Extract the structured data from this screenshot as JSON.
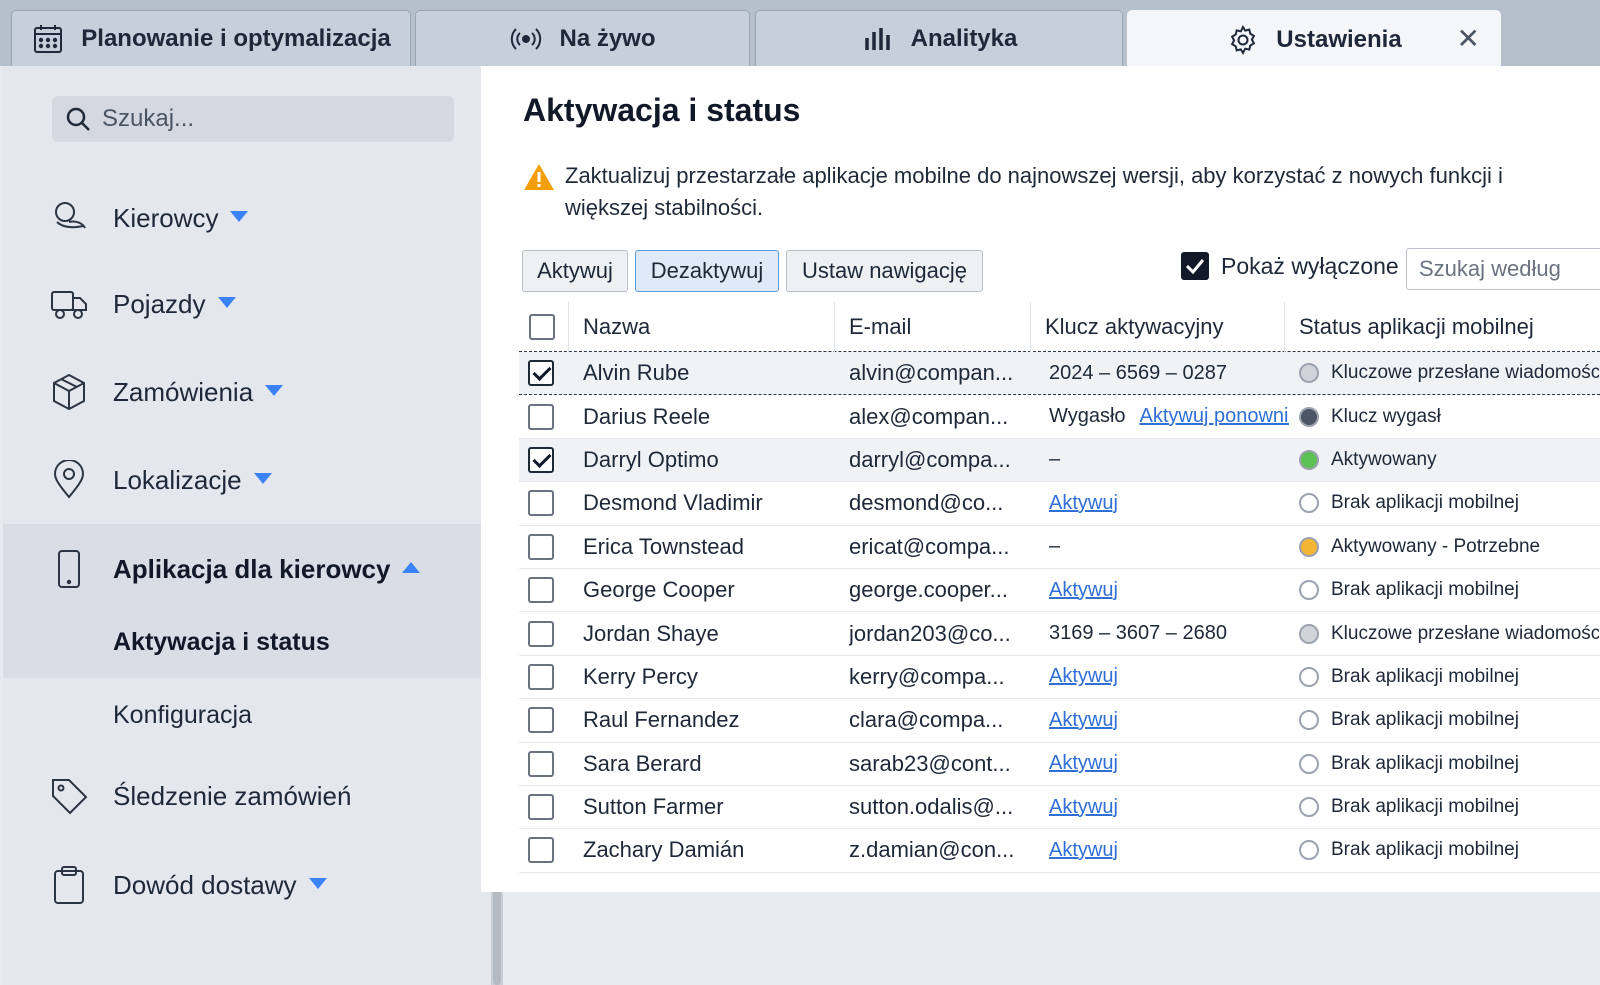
{
  "tabs": [
    {
      "label": "Planowanie i optymalizacja",
      "icon": "calendar-icon"
    },
    {
      "label": "Na żywo",
      "icon": "broadcast-icon"
    },
    {
      "label": "Analityka",
      "icon": "bar-chart-icon"
    },
    {
      "label": "Ustawienia",
      "icon": "gear-icon",
      "active": true
    }
  ],
  "tab_close": "✕",
  "sidebar": {
    "search_placeholder": "Szukaj...",
    "items": [
      {
        "label": "Kierowcy",
        "icon": "users-icon",
        "caret": "down"
      },
      {
        "label": "Pojazdy",
        "icon": "truck-icon",
        "caret": "down"
      },
      {
        "label": "Zamówienia",
        "icon": "box-icon",
        "caret": "down"
      },
      {
        "label": "Lokalizacje",
        "icon": "location-pin-icon",
        "caret": "down"
      },
      {
        "label": "Aplikacja dla kierowcy",
        "icon": "mobile-phone-icon",
        "caret": "up",
        "expanded": true
      },
      {
        "label": "Śledzenie zamówień",
        "icon": "tag-icon"
      },
      {
        "label": "Dowód dostawy",
        "icon": "clipboard-icon",
        "caret": "down"
      }
    ],
    "sub_items": [
      {
        "label": "Aktywacja i status",
        "active": true
      },
      {
        "label": "Konfiguracja"
      }
    ]
  },
  "main": {
    "title": "Aktywacja i status",
    "warning": "Zaktualizuj przestarzałe aplikacje mobilne do najnowszej wersji, aby korzystać z nowych funkcji i większej stabilności.",
    "buttons": {
      "activate": "Aktywuj",
      "deactivate": "Dezaktywuj",
      "set_navigation": "Ustaw nawigację"
    },
    "show_disabled_label": "Pokaż wyłączone",
    "show_disabled_checked": true,
    "filter_placeholder": "Szukaj według"
  },
  "table": {
    "columns": [
      "Nazwa",
      "E-mail",
      "Klucz aktywacyjny",
      "Status aplikacji mobilnej"
    ],
    "rows": [
      {
        "checked": true,
        "name": "Alvin Rube",
        "email": "alvin@compan...",
        "key": "2024 – 6569 – 0287",
        "key_link": "",
        "status": "Kluczowe przesłane wiadomości",
        "status_color": "grey"
      },
      {
        "checked": false,
        "name": "Darius Reele",
        "email": "alex@compan...",
        "key": "Wygasło",
        "key_link": "Aktywuj ponownie",
        "status": "Klucz wygasł",
        "status_color": "dark"
      },
      {
        "checked": true,
        "name": "Darryl Optimo",
        "email": "darryl@compa...",
        "key": "–",
        "key_link": "",
        "status": "Aktywowany",
        "status_color": "green"
      },
      {
        "checked": false,
        "name": "Desmond Vladimir",
        "email": "desmond@co...",
        "key": "",
        "key_link": "Aktywuj",
        "status": "Brak aplikacji mobilnej",
        "status_color": "empty"
      },
      {
        "checked": false,
        "name": "Erica Townstead",
        "email": "ericat@compa...",
        "key": "–",
        "key_link": "",
        "status": "Aktywowany - Potrzebne",
        "status_color": "orange"
      },
      {
        "checked": false,
        "name": "George Cooper",
        "email": "george.cooper...",
        "key": "",
        "key_link": "Aktywuj",
        "status": "Brak aplikacji mobilnej",
        "status_color": "empty"
      },
      {
        "checked": false,
        "name": "Jordan Shaye",
        "email": "jordan203@co...",
        "key": "3169 – 3607 – 2680",
        "key_link": "",
        "status": "Kluczowe przesłane wiadomości",
        "status_color": "grey"
      },
      {
        "checked": false,
        "name": "Kerry Percy",
        "email": "kerry@compa...",
        "key": "",
        "key_link": "Aktywuj",
        "status": "Brak aplikacji mobilnej",
        "status_color": "empty"
      },
      {
        "checked": false,
        "name": "Raul Fernandez",
        "email": "clara@compa...",
        "key": "",
        "key_link": "Aktywuj",
        "status": "Brak aplikacji mobilnej",
        "status_color": "empty"
      },
      {
        "checked": false,
        "name": "Sara Berard",
        "email": "sarab23@cont...",
        "key": "",
        "key_link": "Aktywuj",
        "status": "Brak aplikacji mobilnej",
        "status_color": "empty"
      },
      {
        "checked": false,
        "name": "Sutton Farmer",
        "email": "sutton.odalis@...",
        "key": "",
        "key_link": "Aktywuj",
        "status": "Brak aplikacji mobilnej",
        "status_color": "empty"
      },
      {
        "checked": false,
        "name": "Zachary Damián",
        "email": "z.damian@con...",
        "key": "",
        "key_link": "Aktywuj",
        "status": "Brak aplikacji mobilnej",
        "status_color": "empty"
      }
    ]
  },
  "colors": {
    "accent": "#3b82f6",
    "link": "#2f6fd6",
    "warning": "#f59e0b",
    "status_green": "#5cc254",
    "status_orange": "#f2b632",
    "status_dark": "#4b5563",
    "status_grey": "#d1d5db"
  }
}
